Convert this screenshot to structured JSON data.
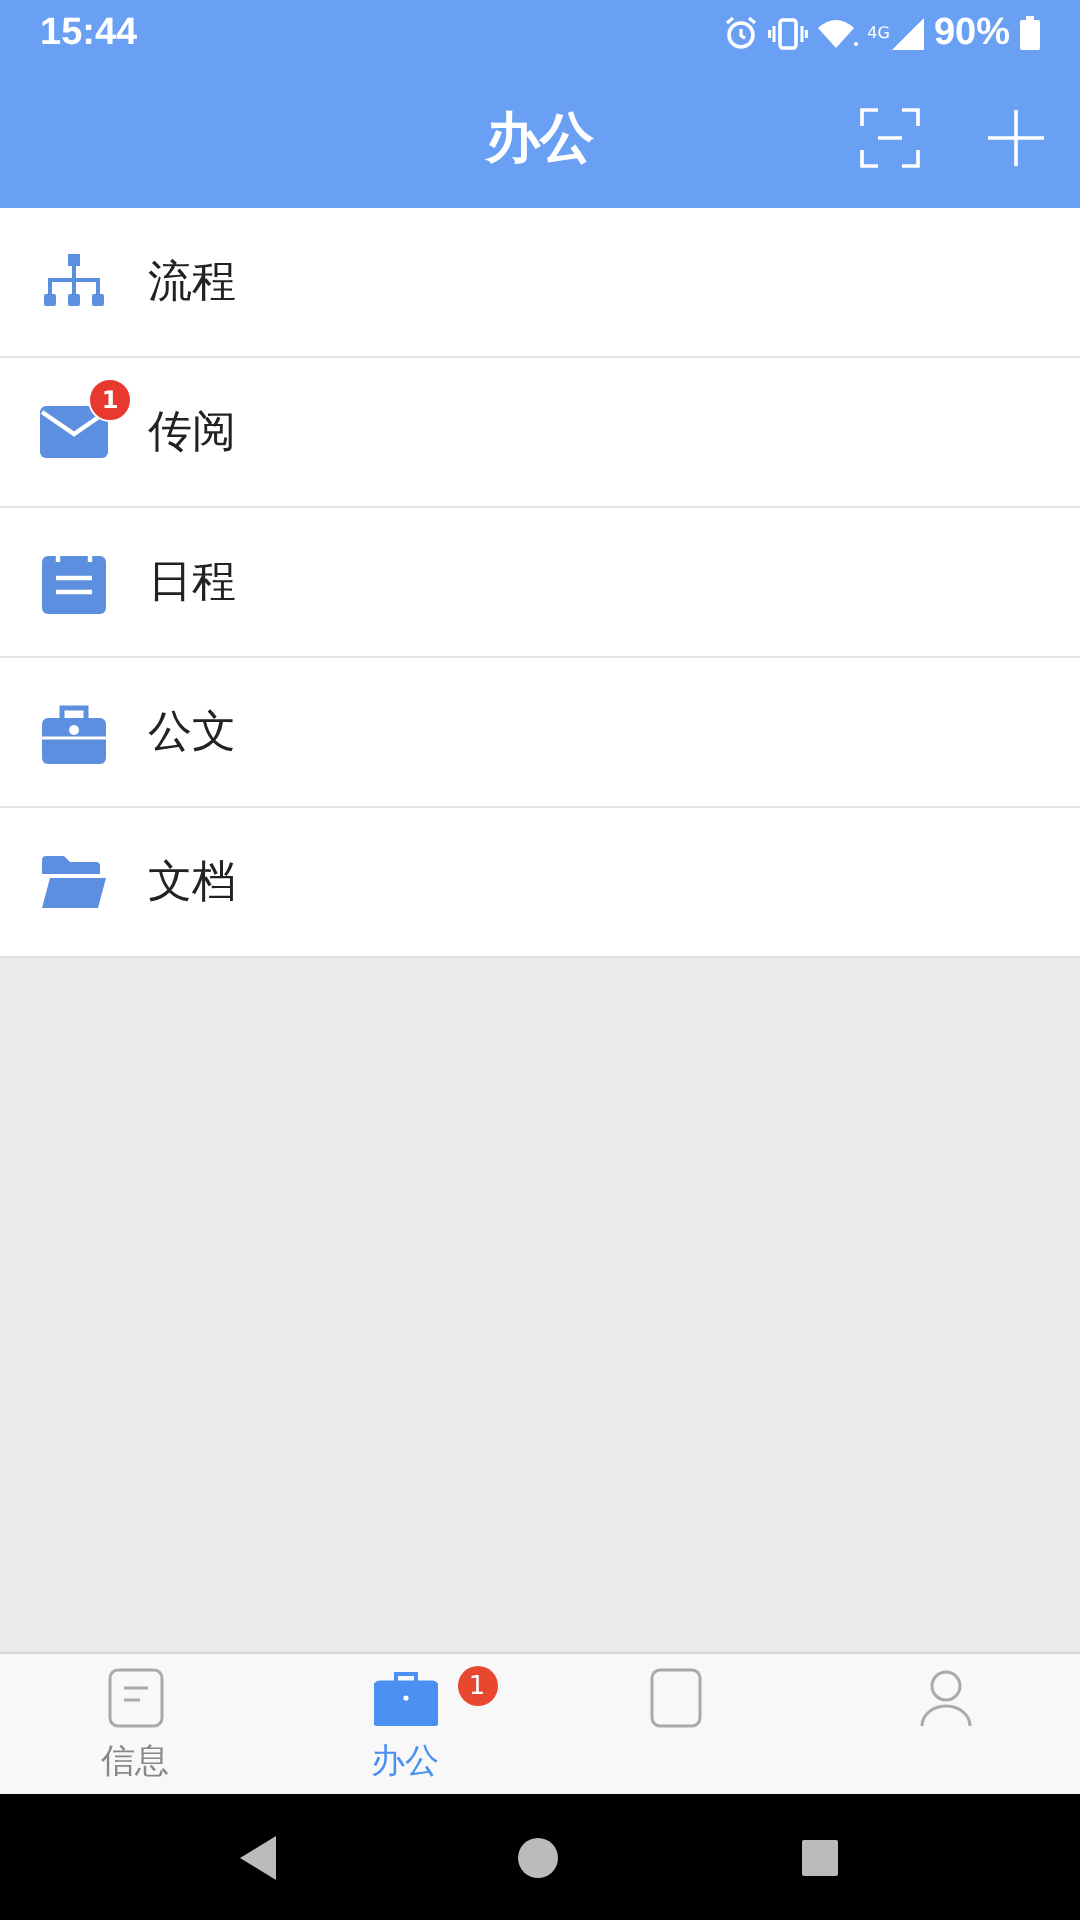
{
  "status_bar": {
    "time": "15:44",
    "network": "4G",
    "battery": "90%"
  },
  "header": {
    "title": "办公"
  },
  "menu": [
    {
      "label": "流程"
    },
    {
      "label": "传阅",
      "badge": "1"
    },
    {
      "label": "日程"
    },
    {
      "label": "公文"
    },
    {
      "label": "文档"
    }
  ],
  "tabs": [
    {
      "label": "信息",
      "selected": false
    },
    {
      "label": "办公",
      "selected": true,
      "badge": "1"
    },
    {
      "selected": false
    },
    {
      "selected": false
    }
  ]
}
